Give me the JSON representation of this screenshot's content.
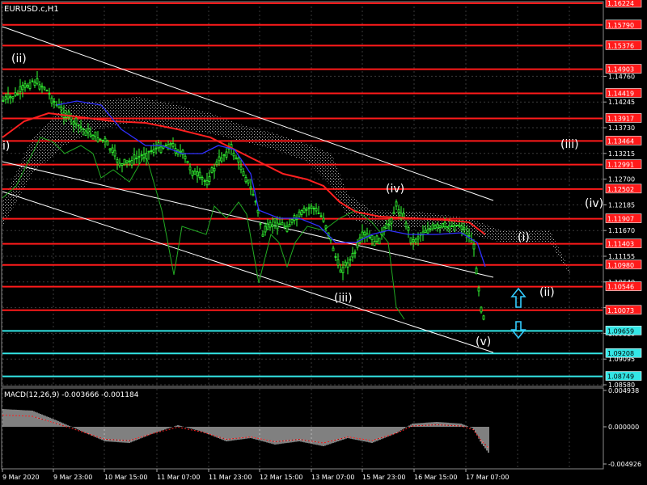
{
  "symbol_label": "EURUSD.c,H1",
  "indicator_label": "MACD(12,26,9) -0.003666 -0.001184",
  "colors": {
    "background": "#000000",
    "grid": "#3a3a3a",
    "axis_text": "#ffffff",
    "bull_candle": "#33ff33",
    "bear_candle": "#33ff33",
    "ma_red": "#ff2020",
    "ma_blue": "#3030ff",
    "green_line": "#22aa22",
    "ichimoku_cloud": "#c8c8c8",
    "h_red_line": "#ff1a1a",
    "h_cyan_line": "#33e6e6",
    "price_box_red": "#ff1a1a",
    "price_box_cyan": "#33e6e6",
    "channel_line": "#ffffff",
    "arrow_up": "#33ccff",
    "arrow_down": "#33ccff",
    "macd_hist": "#ffffff",
    "macd_signal": "#ff2020"
  },
  "price_axis_labels": [
    "1.16224",
    "1.15790",
    "1.15376",
    "1.14903",
    "1.14760",
    "1.14419",
    "1.14245",
    "1.13917",
    "1.13730",
    "1.13464",
    "1.13215",
    "1.12991",
    "1.12700",
    "1.12502",
    "1.12185",
    "1.11907",
    "1.11670",
    "1.11403",
    "1.11155",
    "1.10980",
    "1.10640",
    "1.10546",
    "1.10125",
    "1.10073",
    "1.09659",
    "1.09610",
    "1.09208",
    "1.09095",
    "1.08749",
    "1.08580"
  ],
  "boxed_levels": [
    {
      "price": "1.16224",
      "kind": "red"
    },
    {
      "price": "1.15790",
      "kind": "red"
    },
    {
      "price": "1.15376",
      "kind": "red"
    },
    {
      "price": "1.14903",
      "kind": "red"
    },
    {
      "price": "1.14419",
      "kind": "red"
    },
    {
      "price": "1.13917",
      "kind": "red"
    },
    {
      "price": "1.13464",
      "kind": "red"
    },
    {
      "price": "1.12991",
      "kind": "red"
    },
    {
      "price": "1.12502",
      "kind": "red"
    },
    {
      "price": "1.11907",
      "kind": "red"
    },
    {
      "price": "1.11403",
      "kind": "red"
    },
    {
      "price": "1.10980",
      "kind": "red"
    },
    {
      "price": "1.10546",
      "kind": "red"
    },
    {
      "price": "1.10073",
      "kind": "red"
    },
    {
      "price": "1.09659",
      "kind": "cyan"
    },
    {
      "price": "1.09208",
      "kind": "cyan"
    },
    {
      "price": "1.08749",
      "kind": "cyan"
    }
  ],
  "plain_levels": [
    "1.14760",
    "1.14245",
    "1.13730",
    "1.13215",
    "1.12700",
    "1.12185",
    "1.11670",
    "1.11155",
    "1.10640",
    "1.10125",
    "1.09610",
    "1.09095",
    "1.08580"
  ],
  "macd_axis_labels": [
    "0.004938",
    "0.000000",
    "-0.004926"
  ],
  "time_axis_labels": [
    "9 Mar 2020",
    "9 Mar 23:00",
    "10 Mar 15:00",
    "11 Mar 07:00",
    "11 Mar 23:00",
    "12 Mar 15:00",
    "13 Mar 07:00",
    "15 Mar 23:00",
    "16 Mar 15:00",
    "17 Mar 07:00"
  ],
  "wave_labels": [
    {
      "text": "(ii)"
    },
    {
      "text": "i)"
    },
    {
      "text": "(iii)"
    },
    {
      "text": "(iv)"
    },
    {
      "text": "(v)"
    },
    {
      "text": "(iii)"
    },
    {
      "text": "(iv)"
    },
    {
      "text": "(i)"
    },
    {
      "text": "(ii)"
    }
  ],
  "arrows": {
    "up": "up-arrow-icon",
    "down": "down-arrow-icon"
  }
}
